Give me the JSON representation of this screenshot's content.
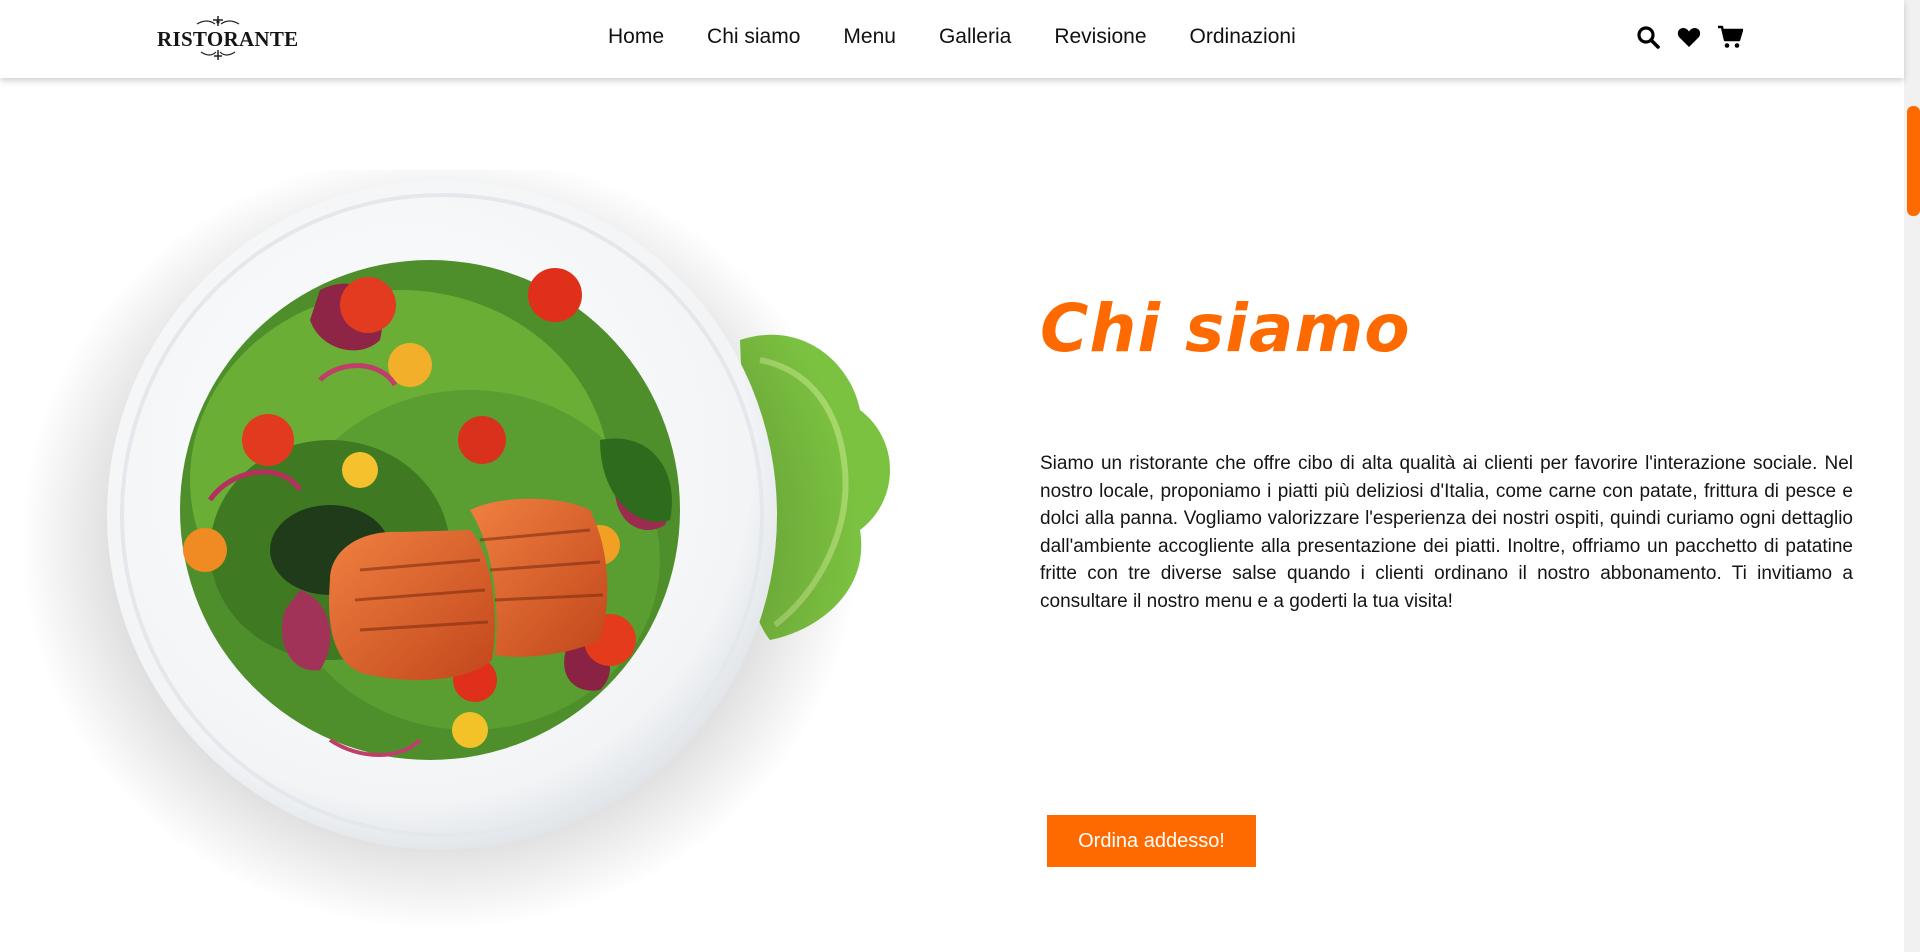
{
  "header": {
    "logo_text": "RISTORANTE",
    "nav": [
      "Home",
      "Chi siamo",
      "Menu",
      "Galleria",
      "Revisione",
      "Ordinazioni"
    ],
    "icons": [
      "search-icon",
      "heart-icon",
      "cart-icon"
    ]
  },
  "about": {
    "title": "Chi siamo",
    "text": "Siamo un ristorante che offre cibo di alta qualità ai clienti per favorire l'interazione sociale. Nel nostro locale, proponiamo i piatti più deliziosi d'Italia, come carne con patate, frittura di pesce e dolci alla panna. Vogliamo valorizzare l'esperienza dei nostri ospiti, quindi curiamo ogni dettaglio dall'ambiente accogliente alla presentazione dei piatti. Inoltre, offriamo un pacchetto di patatine fritte con tre diverse salse quando i clienti ordinano il nostro abbonamento. Ti invitiamo a consultare il nostro menu e a goderti la tua visita!",
    "button_label": "Ordina addesso!"
  },
  "colors": {
    "accent": "#ff6a00",
    "text": "#151515",
    "background": "#ffffff"
  }
}
